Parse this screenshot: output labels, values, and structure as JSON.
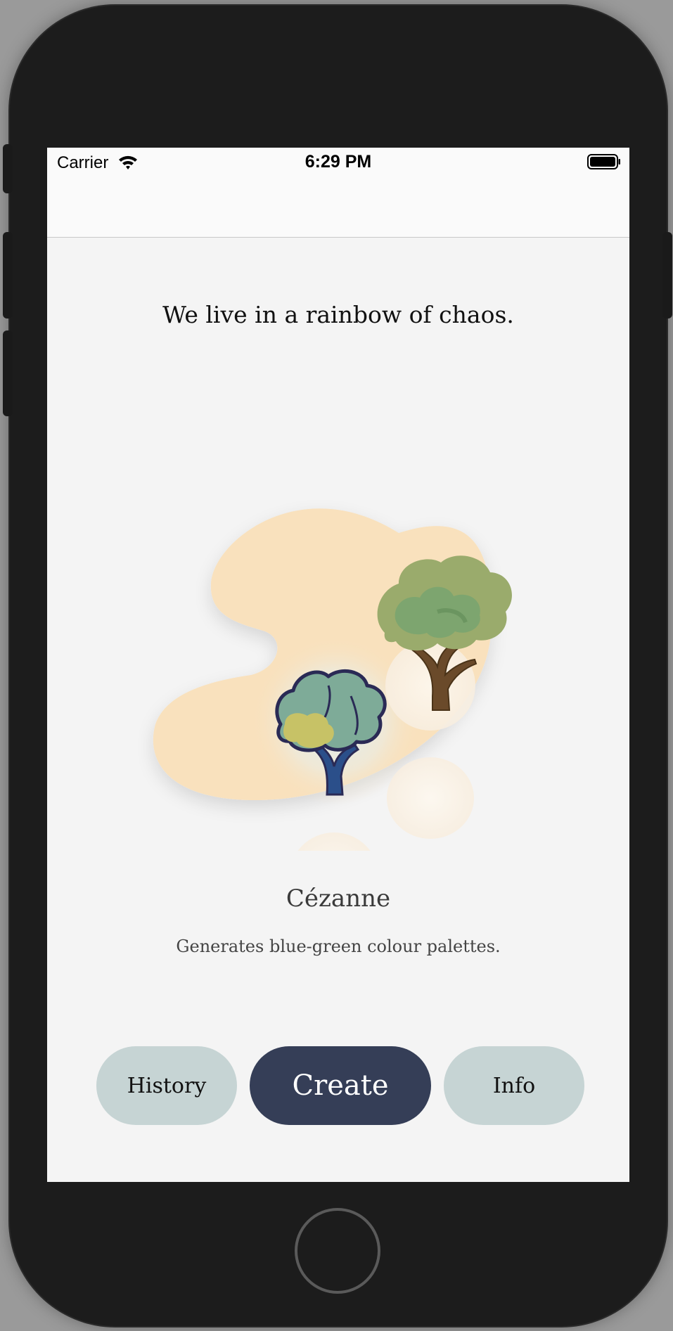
{
  "status_bar": {
    "carrier": "Carrier",
    "time": "6:29 PM",
    "wifi_icon": "wifi-icon",
    "battery_icon": "battery-icon"
  },
  "main": {
    "tagline": "We live in a rainbow of chaos.",
    "illustration": {
      "palette_color": "#f9e1bd",
      "tree_top_colors": [
        "#9aab6c",
        "#7da56f",
        "#6a4a2a"
      ],
      "tree_bottom_colors": [
        "#c7c266",
        "#7eab98",
        "#2b4f8a",
        "#2a2a55"
      ]
    },
    "style_name": "Cézanne",
    "style_description": "Generates blue-green colour palettes."
  },
  "actions": {
    "history_label": "History",
    "create_label": "Create",
    "info_label": "Info"
  },
  "colors": {
    "accent_dark": "#353e57",
    "accent_light": "#c6d4d4",
    "screen_bg": "#f4f4f4"
  }
}
